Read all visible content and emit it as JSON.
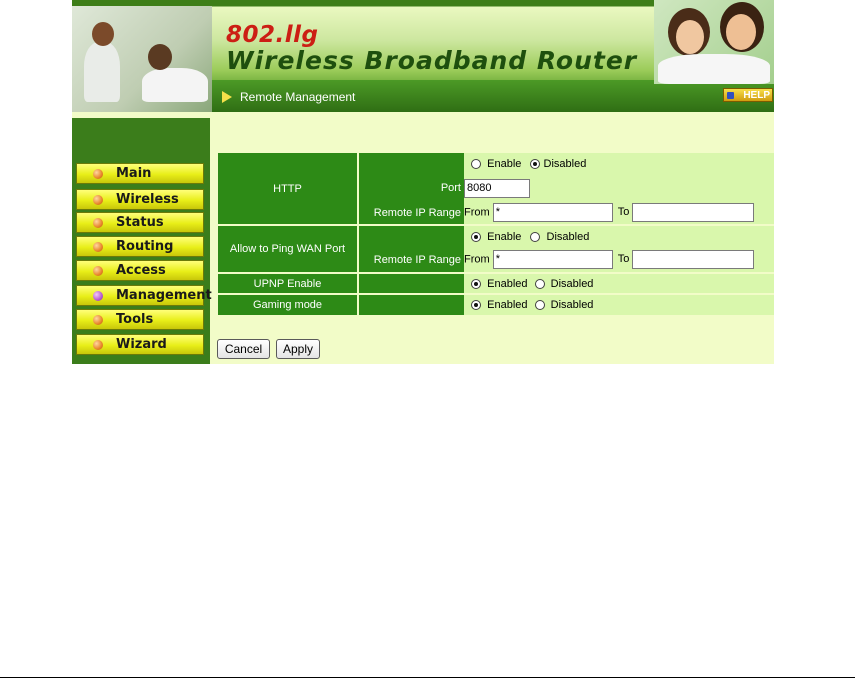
{
  "header": {
    "product_line": "802.llg",
    "title": "Wireless Broadband Router",
    "section_title": "Remote Management",
    "help_label": "HELP"
  },
  "sidebar": {
    "items": [
      {
        "label": "Main",
        "active": false
      },
      {
        "label": "Wireless",
        "active": false
      },
      {
        "label": "Status",
        "active": false
      },
      {
        "label": "Routing",
        "active": false
      },
      {
        "label": "Access",
        "active": false
      },
      {
        "label": "Management",
        "active": true
      },
      {
        "label": "Tools",
        "active": false
      },
      {
        "label": "Wizard",
        "active": false
      }
    ]
  },
  "form": {
    "http": {
      "label": "HTTP",
      "enable_label": "Enable",
      "disable_label": "Disabled",
      "selected": "Disabled",
      "port_label": "Port",
      "port_value": "8080",
      "remote_ip_label": "Remote IP Range",
      "from_label": "From",
      "from_value": "*",
      "to_label": "To",
      "to_value": ""
    },
    "ping": {
      "label": "Allow to Ping WAN Port",
      "enable_label": "Enable",
      "disable_label": "Disabled",
      "selected": "Enable",
      "remote_ip_label": "Remote IP Range",
      "from_label": "From",
      "from_value": "*",
      "to_label": "To",
      "to_value": ""
    },
    "upnp": {
      "label": "UPNP Enable",
      "enable_label": "Enabled",
      "disable_label": "Disabled",
      "selected": "Enabled"
    },
    "gaming": {
      "label": "Gaming mode",
      "enable_label": "Enabled",
      "disable_label": "Disabled",
      "selected": "Enabled"
    }
  },
  "buttons": {
    "cancel": "Cancel",
    "apply": "Apply"
  },
  "colors": {
    "label_bg": "#2d8a16",
    "value_bg": "#d9f7ac",
    "page_bg": "#f2fcc8",
    "sidebar_bg": "#3b7d1b",
    "nav_button": "#e8ee18",
    "logo_red": "#cc1e14"
  }
}
